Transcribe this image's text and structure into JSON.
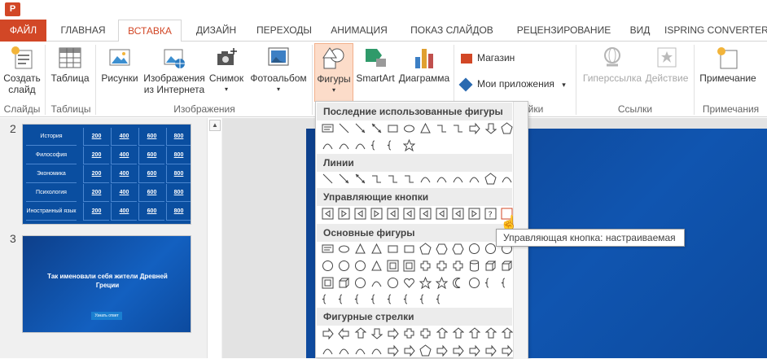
{
  "tabs": [
    {
      "label": "ФАЙЛ"
    },
    {
      "label": "ГЛАВНАЯ"
    },
    {
      "label": "ВСТАВКА"
    },
    {
      "label": "ДИЗАЙН"
    },
    {
      "label": "ПЕРЕХОДЫ"
    },
    {
      "label": "АНИМАЦИЯ"
    },
    {
      "label": "ПОКАЗ СЛАЙДОВ"
    },
    {
      "label": "РЕЦЕНЗИРОВАНИЕ"
    },
    {
      "label": "ВИД"
    },
    {
      "label": "ISPRING CONVERTER"
    }
  ],
  "ribbon": {
    "new_slide": "Создать слайд",
    "table": "Таблица",
    "pictures": "Рисунки",
    "online_pictures": "Изображения из Интернета",
    "screenshot": "Снимок",
    "photo_album": "Фотоальбом",
    "shapes": "Фигуры",
    "smartart": "SmartArt",
    "chart": "Диаграмма",
    "store": "Магазин",
    "my_apps": "Мои приложения",
    "hyperlink": "Гиперссылка",
    "action": "Действие",
    "comment": "Примечание",
    "groups": {
      "slides": "Слайды",
      "tables": "Таблицы",
      "images": "Изображения",
      "apps": "йки",
      "links": "Ссылки",
      "comments": "Примечания"
    }
  },
  "slides": {
    "slide2_num": "2",
    "slide3_num": "3",
    "slide2_rows": [
      {
        "topic": "История",
        "v": [
          "200",
          "400",
          "600",
          "800"
        ]
      },
      {
        "topic": "Философия",
        "v": [
          "200",
          "400",
          "600",
          "800"
        ]
      },
      {
        "topic": "Экономика",
        "v": [
          "200",
          "400",
          "600",
          "800"
        ]
      },
      {
        "topic": "Психология",
        "v": [
          "200",
          "400",
          "600",
          "800"
        ]
      },
      {
        "topic": "Иностранный язык",
        "v": [
          "200",
          "400",
          "600",
          "800"
        ]
      }
    ],
    "slide3_title": "Так именовали себя жители Древней Греции",
    "slide3_button": "Узнать ответ"
  },
  "dropdown": {
    "recent": "Последние использованные фигуры",
    "lines": "Линии",
    "action_buttons": "Управляющие кнопки",
    "basic": "Основные фигуры",
    "arrows": "Фигурные стрелки"
  },
  "tooltip": "Управляющая кнопка: настраиваемая",
  "colors": {
    "accent": "#d24726",
    "slide_blue": "#0a4ea0"
  }
}
